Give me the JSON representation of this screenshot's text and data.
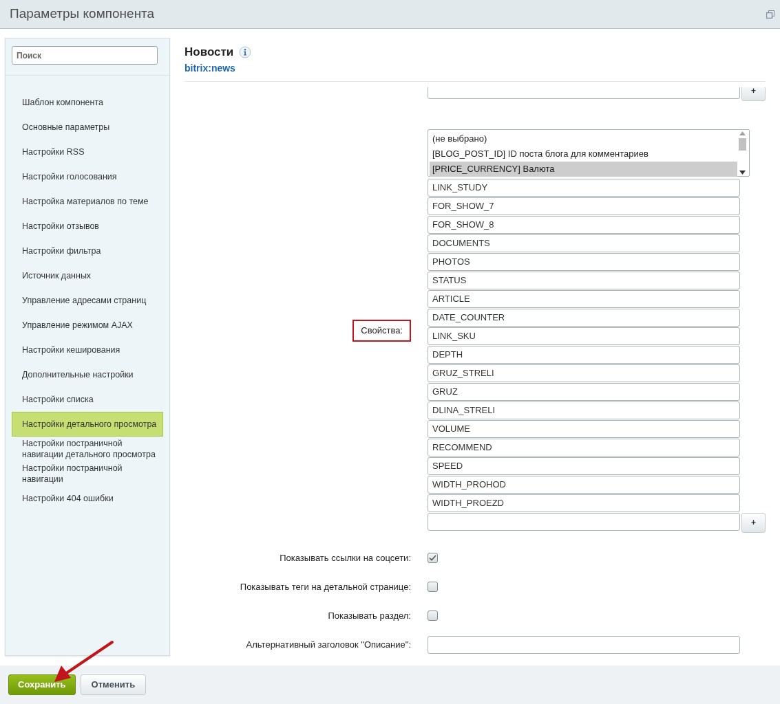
{
  "window": {
    "title": "Параметры компонента"
  },
  "sidebar": {
    "search": {
      "placeholder": "Поиск"
    },
    "items": [
      {
        "label": "Шаблон компонента",
        "selected": false
      },
      {
        "label": "Основные параметры",
        "selected": false
      },
      {
        "label": "Настройки RSS",
        "selected": false
      },
      {
        "label": "Настройки голосования",
        "selected": false
      },
      {
        "label": "Настройка материалов по теме",
        "selected": false
      },
      {
        "label": "Настройки отзывов",
        "selected": false
      },
      {
        "label": "Настройки фильтра",
        "selected": false
      },
      {
        "label": "Источник данных",
        "selected": false
      },
      {
        "label": "Управление адресами страниц",
        "selected": false
      },
      {
        "label": "Управление режимом AJAX",
        "selected": false
      },
      {
        "label": "Настройки кеширования",
        "selected": false
      },
      {
        "label": "Дополнительные настройки",
        "selected": false
      },
      {
        "label": "Настройки списка",
        "selected": false
      },
      {
        "label": "Настройки детального просмотра",
        "selected": true
      },
      {
        "label": "Настройки постраничной навигации детального просмотра",
        "selected": false
      },
      {
        "label": "Настройки постраничной навигации",
        "selected": false
      },
      {
        "label": "Настройки 404 ошибки",
        "selected": false
      }
    ]
  },
  "component": {
    "title": "Новости",
    "code": "bitrix:news"
  },
  "top_field": {
    "add_label": "+"
  },
  "properties": {
    "label": "Свойства:",
    "options": [
      {
        "label": "(не выбрано)",
        "selected": false
      },
      {
        "label": "[BLOG_POST_ID] ID поста блога для комментариев",
        "selected": false
      },
      {
        "label": "[PRICE_CURRENCY] Валюта",
        "selected": true
      }
    ],
    "values": [
      "LINK_STUDY",
      "FOR_SHOW_7",
      "FOR_SHOW_8",
      "DOCUMENTS",
      "PHOTOS",
      "STATUS",
      "ARTICLE",
      "DATE_COUNTER",
      "LINK_SKU",
      "DEPTH",
      "GRUZ_STRELI",
      "GRUZ",
      "DLINA_STRELI",
      "VOLUME",
      "RECOMMEND",
      "SPEED",
      "WIDTH_PROHOD",
      "WIDTH_PROEZD"
    ],
    "add_label": "+"
  },
  "settings": [
    {
      "kind": "checkbox",
      "label": "Показывать ссылки на соцсети:",
      "checked": true
    },
    {
      "kind": "checkbox",
      "label": "Показывать теги на детальной странице:",
      "checked": false
    },
    {
      "kind": "checkbox",
      "label": "Показывать раздел:",
      "checked": false
    },
    {
      "kind": "text",
      "label": "Альтернативный заголовок \"Описание\":"
    }
  ],
  "buttons": [
    {
      "label": "Сохранить",
      "kind": "primary"
    },
    {
      "label": "Отменить",
      "kind": "secondary"
    }
  ]
}
